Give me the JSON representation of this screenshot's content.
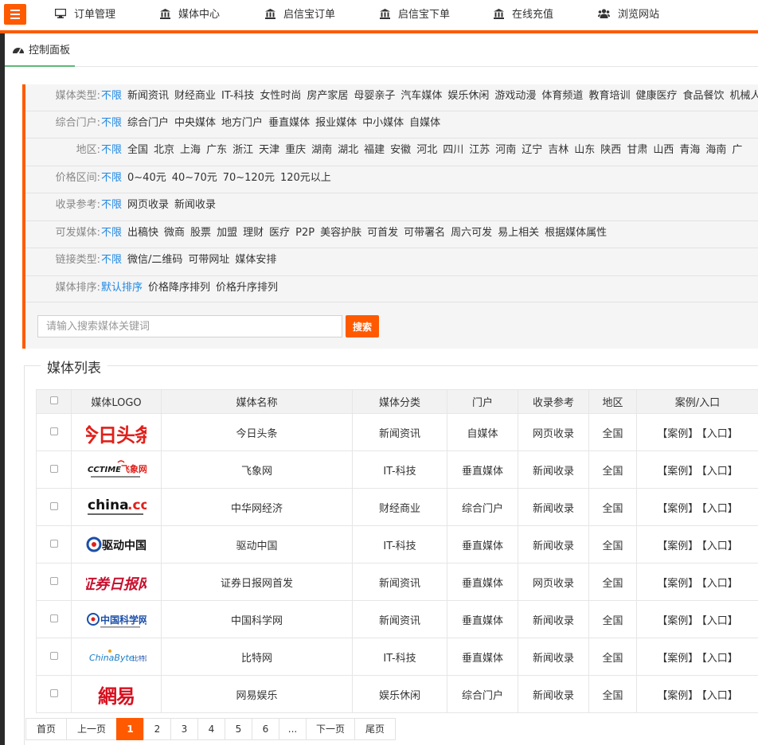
{
  "nav": {
    "items": [
      {
        "label": "订单管理",
        "icon": "monitor-icon"
      },
      {
        "label": "媒体中心",
        "icon": "bank-icon"
      },
      {
        "label": "启信宝订单",
        "icon": "bank-icon"
      },
      {
        "label": "启信宝下单",
        "icon": "bank-icon"
      },
      {
        "label": "在线充值",
        "icon": "bank-icon"
      },
      {
        "label": "浏览网站",
        "icon": "users-icon"
      }
    ]
  },
  "tab": {
    "label": "控制面板",
    "icon": "dashboard-icon"
  },
  "filters": [
    {
      "label": "媒体类型:",
      "options": [
        "不限",
        "新闻资讯",
        "财经商业",
        "IT-科技",
        "女性时尚",
        "房产家居",
        "母婴亲子",
        "汽车媒体",
        "娱乐休闲",
        "游戏动漫",
        "体育频道",
        "教育培训",
        "健康医疗",
        "食品餐饮",
        "机械人"
      ]
    },
    {
      "label": "综合门户:",
      "options": [
        "不限",
        "综合门户",
        "中央媒体",
        "地方门户",
        "垂直媒体",
        "报业媒体",
        "中小媒体",
        "自媒体"
      ]
    },
    {
      "label": "地区:",
      "options": [
        "不限",
        "全国",
        "北京",
        "上海",
        "广东",
        "浙江",
        "天津",
        "重庆",
        "湖南",
        "湖北",
        "福建",
        "安徽",
        "河北",
        "四川",
        "江苏",
        "河南",
        "辽宁",
        "吉林",
        "山东",
        "陕西",
        "甘肃",
        "山西",
        "青海",
        "海南",
        "广"
      ]
    },
    {
      "label": "价格区间:",
      "options": [
        "不限",
        "0~40元",
        "40~70元",
        "70~120元",
        "120元以上"
      ]
    },
    {
      "label": "收录参考:",
      "options": [
        "不限",
        "网页收录",
        "新闻收录"
      ]
    },
    {
      "label": "可发媒体:",
      "options": [
        "不限",
        "出稿快",
        "微商",
        "股票",
        "加盟",
        "理财",
        "医疗",
        "P2P",
        "美容护肤",
        "可首发",
        "可带署名",
        "周六可发",
        "易上相关",
        "根据媒体属性"
      ]
    },
    {
      "label": "链接类型:",
      "options": [
        "不限",
        "微信/二维码",
        "可带网址",
        "媒体安排"
      ]
    },
    {
      "label": "媒体排序:",
      "options": [
        "默认排序",
        "价格降序排列",
        "价格升序排列"
      ]
    }
  ],
  "search": {
    "placeholder": "请输入搜索媒体关键词",
    "button": "搜索"
  },
  "list": {
    "legend": "媒体列表",
    "headers": [
      "",
      "媒体LOGO",
      "媒体名称",
      "媒体分类",
      "门户",
      "收录参考",
      "地区",
      "案例/入口"
    ],
    "case_label": "【案例】",
    "entry_label": "【入口】",
    "rows": [
      {
        "logo": "今日头条",
        "name": "今日头条",
        "category": "新闻资讯",
        "portal": "自媒体",
        "index": "网页收录",
        "region": "全国"
      },
      {
        "logo": "CCTIME飞象网",
        "name": "飞象网",
        "category": "IT-科技",
        "portal": "垂直媒体",
        "index": "新闻收录",
        "region": "全国"
      },
      {
        "logo": "china.com",
        "name": "中华网经济",
        "category": "财经商业",
        "portal": "综合门户",
        "index": "新闻收录",
        "region": "全国"
      },
      {
        "logo": "驱动中国",
        "name": "驱动中国",
        "category": "IT-科技",
        "portal": "垂直媒体",
        "index": "新闻收录",
        "region": "全国"
      },
      {
        "logo": "证券日报网",
        "name": "证券日报网首发",
        "category": "新闻资讯",
        "portal": "垂直媒体",
        "index": "网页收录",
        "region": "全国"
      },
      {
        "logo": "中国科学网",
        "name": "中国科学网",
        "category": "新闻资讯",
        "portal": "垂直媒体",
        "index": "新闻收录",
        "region": "全国"
      },
      {
        "logo": "ChinaByte比特网",
        "name": "比特网",
        "category": "IT-科技",
        "portal": "垂直媒体",
        "index": "新闻收录",
        "region": "全国"
      },
      {
        "logo": "网易娱乐",
        "name": "网易娱乐",
        "category": "娱乐休闲",
        "portal": "综合门户",
        "index": "新闻收录",
        "region": "全国"
      }
    ]
  },
  "pager": [
    "首页",
    "上一页",
    "1",
    "2",
    "3",
    "4",
    "5",
    "6",
    "...",
    "下一页",
    "尾页"
  ],
  "colors": {
    "accent": "#ff5a00",
    "link": "#1e88e5",
    "tab_underline": "#5fb878"
  }
}
